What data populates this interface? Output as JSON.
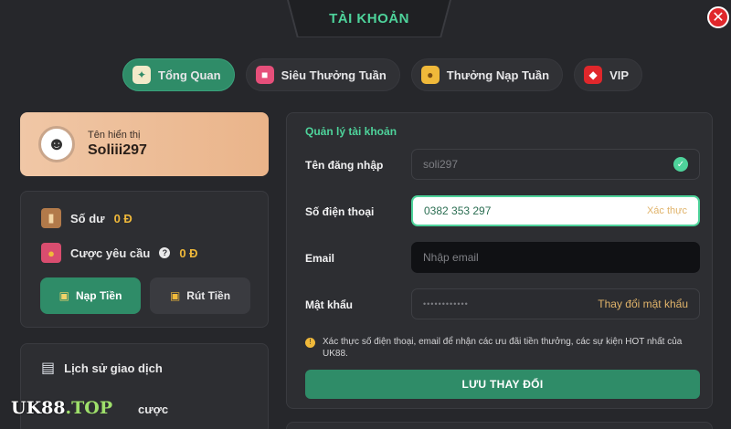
{
  "header": {
    "title": "TÀI KHOẢN",
    "close_glyph": "✕"
  },
  "tabs": [
    {
      "label": "Tổng Quan",
      "icon": "overview-icon",
      "active": true
    },
    {
      "label": "Siêu Thưởng Tuần",
      "icon": "gift-icon",
      "active": false
    },
    {
      "label": "Thưởng Nạp Tuần",
      "icon": "coins-icon",
      "active": false
    },
    {
      "label": "VIP",
      "icon": "diamond-icon",
      "active": false
    }
  ],
  "profile": {
    "label": "Tên hiển thị",
    "name": "Soliii297"
  },
  "balance": {
    "balance_label": "Số dư",
    "balance_value": "0 Đ",
    "required_label": "Cược yêu cầu",
    "required_value": "0 Đ",
    "deposit_label": "Nạp Tiền",
    "withdraw_label": "Rút Tiền"
  },
  "history": {
    "transactions_label": "Lịch sử giao dịch",
    "bets_label": "cược"
  },
  "logo": {
    "text_main": "UK88",
    "text_suffix": ".TOP"
  },
  "account": {
    "title": "Quản lý tài khoản",
    "username_label": "Tên đăng nhập",
    "username_value": "soli297",
    "phone_label": "Số điện thoại",
    "phone_value": "0382 353 297",
    "phone_verify": "Xác thực",
    "email_label": "Email",
    "email_placeholder": "Nhập email",
    "password_label": "Mật khẩu",
    "password_value": "••••••••••••",
    "password_change": "Thay đổi mật khẩu",
    "note": "Xác thực số điện thoại, email để nhận các ưu đãi tiền thưởng, các sự kiện HOT nhất của UK88.",
    "save_label": "LƯU THAY ĐỔI"
  },
  "colors": {
    "accent": "#4ed39b",
    "button_green": "#2f8c68",
    "gold": "#f0b93a",
    "close_red": "#e0272b"
  }
}
